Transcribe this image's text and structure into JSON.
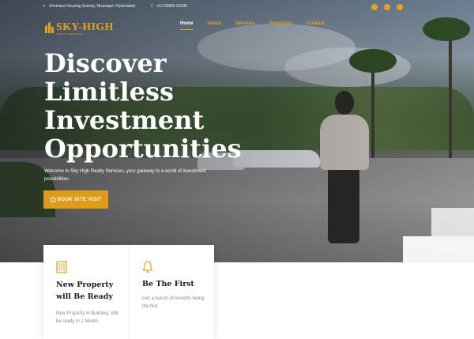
{
  "topbar": {
    "address": "Srinivasa Housing Society, Nizampet, Hyderabad",
    "phone": "+91 83860 62335",
    "social": [
      "facebook-icon",
      "instagram-icon",
      "youtube-icon"
    ]
  },
  "brand": {
    "name": "SKY-HIGH",
    "tagline": "REALTY SERVICES",
    "accent": "#e5a21c"
  },
  "nav": {
    "items": [
      {
        "label": "Home",
        "active": true
      },
      {
        "label": "About",
        "active": false
      },
      {
        "label": "Services",
        "active": false
      },
      {
        "label": "Properties",
        "active": false
      },
      {
        "label": "Contact",
        "active": false
      }
    ]
  },
  "hero": {
    "headline": [
      "Discover",
      "Limitless",
      "Investment",
      "Opportunities"
    ],
    "subtext": "Welcome to Sky High Realty Services, your gateway to a world of investment possibilities.",
    "cta_label": "BOOK SITE VISIT",
    "cta_color": "#e09b19"
  },
  "features": [
    {
      "icon": "building-icon",
      "title": "New Property will Be Ready",
      "desc": "New Property in Building, Will be ready in 2 Month"
    },
    {
      "icon": "bell-icon",
      "title": "Be The First",
      "desc": "Get a bunch of benefits being the first."
    }
  ]
}
